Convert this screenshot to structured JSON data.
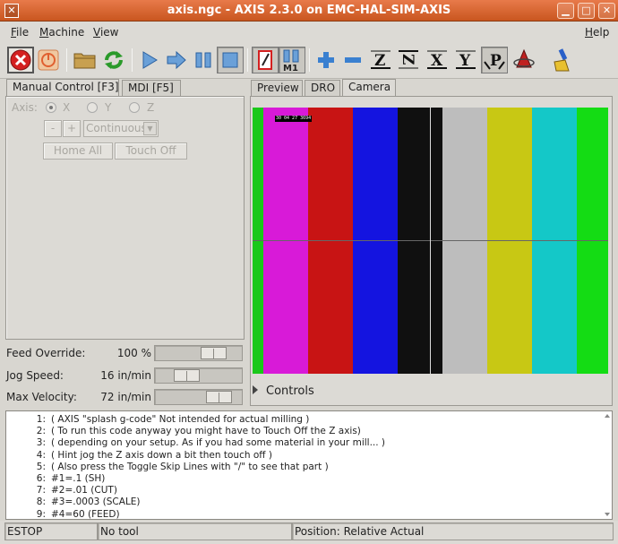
{
  "window": {
    "title": "axis.ngc - AXIS 2.3.0 on EMC-HAL-SIM-AXIS"
  },
  "menubar": {
    "items": [
      {
        "label": "File",
        "u": "F",
        "rest": "ile"
      },
      {
        "label": "Machine",
        "u": "M",
        "rest": "achine"
      },
      {
        "label": "View",
        "u": "V",
        "rest": "iew"
      },
      {
        "label": "Help",
        "u": "H",
        "rest": "elp"
      }
    ]
  },
  "toolbar": {
    "letters": {
      "z": "Z",
      "z_rot": "Z",
      "x": "X",
      "y": "Y",
      "p": "P",
      "m1": "M1"
    }
  },
  "left_tabs": [
    "Manual Control [F3]",
    "MDI [F5]"
  ],
  "manual": {
    "axis_label": "Axis:",
    "axes": [
      "X",
      "Y",
      "Z"
    ],
    "selected_axis": "X",
    "minus": "-",
    "plus": "+",
    "jog_mode": "Continuous",
    "home_all": "Home All",
    "touch_off": "Touch Off"
  },
  "sliders": [
    {
      "label": "Feed Override:",
      "value": "100 %",
      "level": 0.75
    },
    {
      "label": "Jog Speed:",
      "value": "16 in/min",
      "level": 0.3
    },
    {
      "label": "Max Velocity:",
      "value": "72 in/min",
      "level": 0.85
    }
  ],
  "right_tabs": [
    "Preview",
    "DRO",
    "Camera"
  ],
  "camera": {
    "overlay_label": "30 04 27 3694",
    "bars": [
      "#1ac81a",
      "#d81ad8",
      "#c81414",
      "#1414e0",
      "#101010",
      "#bdbdbd",
      "#c8c814",
      "#14c8c8",
      "#14dc14"
    ],
    "controls_label": "Controls"
  },
  "code_lines": [
    {
      "n": "1:",
      "text": "( AXIS \"splash g-code\" Not intended for actual milling )"
    },
    {
      "n": "2:",
      "text": "( To run this code anyway you might have to Touch Off the Z axis)"
    },
    {
      "n": "3:",
      "text": "( depending on your setup. As if you had some material in your mill... )"
    },
    {
      "n": "4:",
      "text": "( Hint jog the Z axis down a bit then touch off )"
    },
    {
      "n": "5:",
      "text": "( Also press the Toggle Skip Lines with \"/\" to see that part )"
    },
    {
      "n": "6:",
      "text": "#1=.1 (SH)"
    },
    {
      "n": "7:",
      "text": "#2=.01 (CUT)"
    },
    {
      "n": "8:",
      "text": "#3=.0003 (SCALE)"
    },
    {
      "n": "9:",
      "text": "#4=60 (FEED)"
    }
  ],
  "status": {
    "state": "ESTOP",
    "tool": "No tool",
    "position": "Position: Relative Actual"
  }
}
